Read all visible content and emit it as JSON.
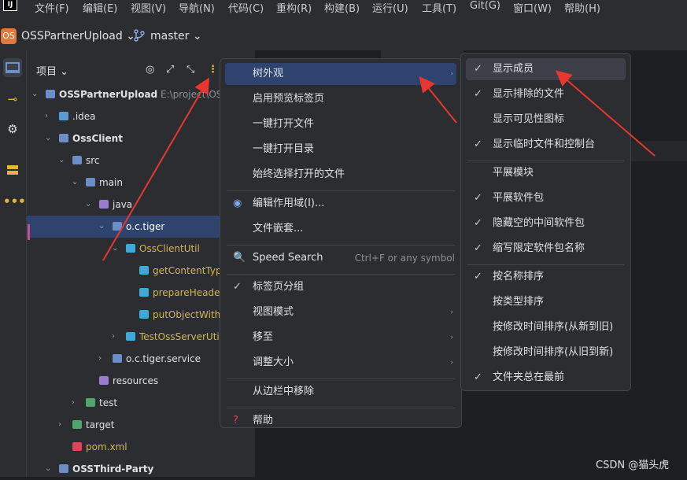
{
  "menubar": {
    "logo": "IJ",
    "items": [
      "文件(F)",
      "编辑(E)",
      "视图(V)",
      "导航(N)",
      "代码(C)",
      "重构(R)",
      "构建(B)",
      "运行(U)",
      "工具(T)",
      "Git(G)",
      "窗口(W)",
      "帮助(H)"
    ]
  },
  "toolbar": {
    "project_badge": "OS",
    "project_name": "OSSPartnerUpload ⌄",
    "branch": "master ⌄",
    "branch_icon": "branch-icon"
  },
  "panel": {
    "title": "项目 ⌄",
    "tree": [
      {
        "label": "OSSPartnerUpload",
        "extra": "E:\\project\\OSS",
        "chev": "⌄",
        "icon_color": "#6b8ec9",
        "bold": true
      },
      {
        "label": ".idea",
        "chev": "›",
        "icon_color": "#5b9bd5"
      },
      {
        "label": "OssClient",
        "chev": "⌄",
        "icon_color": "#6b8ec9",
        "bold": true
      },
      {
        "label": "src",
        "chev": "⌄",
        "icon_color": "#6b8ec9"
      },
      {
        "label": "main",
        "chev": "⌄",
        "icon_color": "#6b8ec9"
      },
      {
        "label": "java",
        "chev": "⌄",
        "icon_color": "#9a7ccf"
      },
      {
        "label": "o.c.tiger",
        "chev": "⌄",
        "icon_color": "#6b8ec9",
        "selected": true
      },
      {
        "label": "OssClientUtil",
        "chev": "⌄",
        "icon_color": "#3fa9d8"
      },
      {
        "label": "getContentType",
        "chev": "",
        "icon_color": "#3fa9d8"
      },
      {
        "label": "prepareHeaders",
        "chev": "",
        "icon_color": "#3fa9d8"
      },
      {
        "label": "putObjectWithH",
        "chev": "",
        "icon_color": "#3fa9d8"
      },
      {
        "label": "TestOssServerUtil",
        "chev": "›",
        "icon_color": "#3fa9d8"
      },
      {
        "label": "o.c.tiger.service",
        "chev": "›",
        "icon_color": "#6b8ec9"
      },
      {
        "label": "resources",
        "chev": "",
        "icon_color": "#9a7ccf"
      },
      {
        "label": "test",
        "chev": "›",
        "icon_color": "#4fa56d"
      },
      {
        "label": "target",
        "chev": "›",
        "icon_color": "#4fa56d"
      },
      {
        "label": "pom.xml",
        "chev": "",
        "icon_color": "#e0435e"
      },
      {
        "label": "OSSThird-Party",
        "chev": "⌄",
        "icon_color": "#6b8ec9",
        "bold": true
      }
    ]
  },
  "context_menu": {
    "items": [
      {
        "label": "树外观",
        "glyph": "",
        "arrow": "›",
        "highlight": true
      },
      {
        "label": "启用预览标签页",
        "glyph": ""
      },
      {
        "label": "一键打开文件",
        "glyph": ""
      },
      {
        "label": "一键打开目录",
        "glyph": ""
      },
      {
        "label": "始终选择打开的文件",
        "glyph": ""
      },
      {
        "label": "编辑作用域(I)...",
        "glyph": "◉",
        "sep_before": true
      },
      {
        "label": "文件嵌套...",
        "glyph": ""
      },
      {
        "label": "Speed Search",
        "glyph": "🔍",
        "shortcut": "Ctrl+F or any symbol",
        "sep_before": true
      },
      {
        "label": "标签页分组",
        "glyph": "✓",
        "sep_before": true
      },
      {
        "label": "视图模式",
        "glyph": "",
        "arrow": "›"
      },
      {
        "label": "移至",
        "glyph": "",
        "arrow": "›"
      },
      {
        "label": "调整大小",
        "glyph": "",
        "arrow": "›"
      },
      {
        "label": "从边栏中移除",
        "glyph": "",
        "sep_before": true
      },
      {
        "label": "帮助",
        "glyph": "?",
        "sep_before": true
      }
    ]
  },
  "submenu": {
    "items": [
      {
        "label": "显示成员",
        "checked": true,
        "highlight": true
      },
      {
        "label": "显示排除的文件",
        "checked": true
      },
      {
        "label": "显示可见性图标",
        "checked": false
      },
      {
        "label": "显示临时文件和控制台",
        "checked": true
      },
      {
        "label": "平展模块",
        "checked": false,
        "sep_before": true
      },
      {
        "label": "平展软件包",
        "checked": true
      },
      {
        "label": "隐藏空的中间软件包",
        "checked": true
      },
      {
        "label": "缩写限定软件包名称",
        "checked": true
      },
      {
        "label": "按名称排序",
        "checked": true,
        "sep_before": true
      },
      {
        "label": "按类型排序",
        "checked": false
      },
      {
        "label": "按修改时间排序(从新到旧)",
        "checked": false
      },
      {
        "label": "按修改时间排序(从旧到新)",
        "checked": false
      },
      {
        "label": "文件夹总在最前",
        "checked": true
      }
    ]
  },
  "watermark": "CSDN @猫头虎",
  "colors": {
    "accent": "#2e436e",
    "arrow": "#e8372f",
    "badge": "#e1793f"
  }
}
